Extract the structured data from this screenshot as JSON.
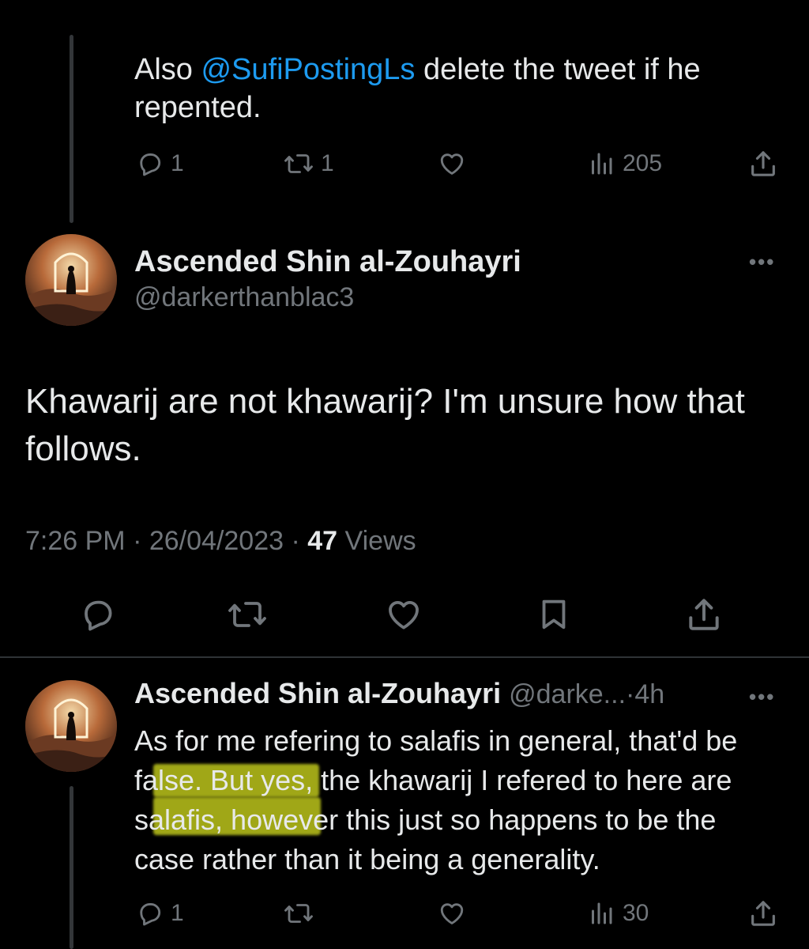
{
  "previous_tweet": {
    "text_before": "Also ",
    "mention": "@SufiPostingLs",
    "text_after": " delete the tweet if he repented.",
    "replies": "1",
    "retweets": "1",
    "likes": "",
    "views": "205"
  },
  "main_tweet": {
    "display_name": "Ascended Shin al-Zouhayri",
    "handle": "@darkerthanblac3",
    "text": "Khawarij are not khawarij? I'm unsure how that follows.",
    "time": "7:26 PM",
    "separator": "·",
    "date": "26/04/2023",
    "views_count": "47",
    "views_label": "Views"
  },
  "reply_tweet": {
    "display_name": "Ascended Shin al-Zouhayri",
    "handle": "@darke...",
    "time_ago": "4h",
    "separator": "·",
    "text": "As for me refering to salafis in general, that'd be false. But yes, the khawarij I refered to here are salafis, however this just so happens to be the case rather than it being a generality.",
    "replies": "1",
    "retweets": "",
    "likes": "",
    "views": "30",
    "highlight_color": "#cdd61e"
  },
  "more_menu": "•••",
  "icons": [
    "reply-icon",
    "retweet-icon",
    "like-icon",
    "views-icon",
    "share-icon",
    "bookmark-icon",
    "more-icon"
  ],
  "colors": {
    "background": "#000000",
    "text": "#e7e9ea",
    "secondary": "#71767b",
    "mention": "#1d9bf0",
    "divider": "#2f3336"
  }
}
